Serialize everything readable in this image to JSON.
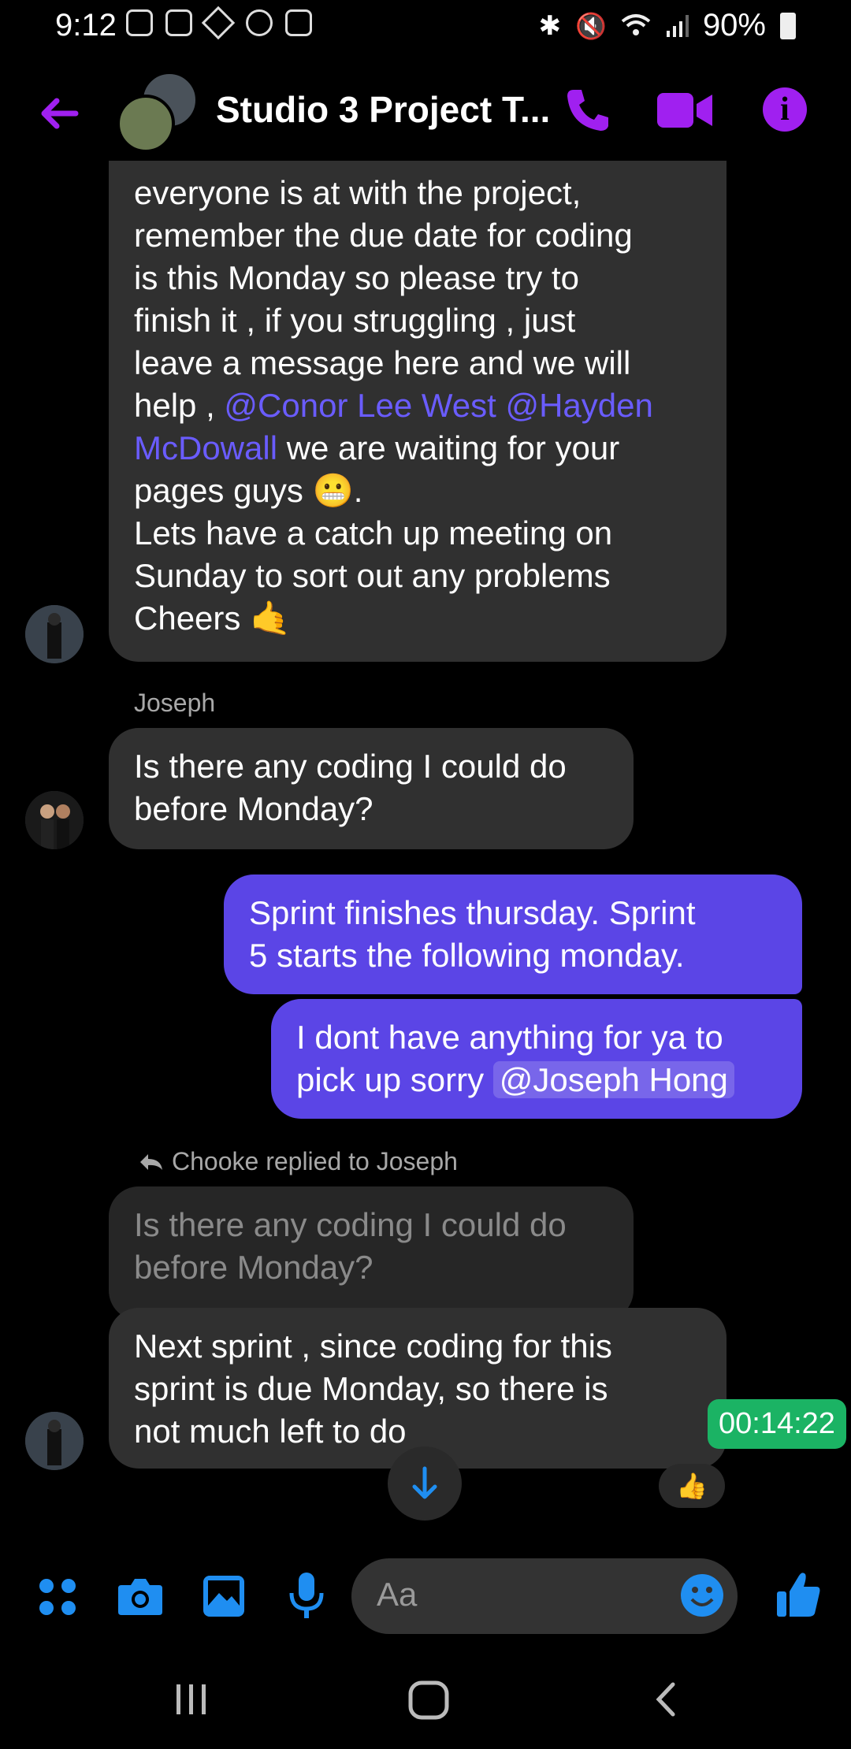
{
  "status_bar": {
    "time": "9:12",
    "battery": "90%"
  },
  "header": {
    "title": "Studio 3 Project T...",
    "accent_color": "#a020f0"
  },
  "messages": {
    "first": {
      "lines": [
        "everyone is at with the project,",
        "remember the due date for coding",
        "is this Monday so please try to",
        "finish it , if you struggling , just",
        "leave a message here and we will"
      ],
      "help_prefix": "help , ",
      "mention1": "@Conor Lee West @Hayden",
      "mention2": "McDowall",
      "after_mention": " we are waiting for your",
      "pages_line": "pages guys 😬.",
      "line_catchup1": "Lets have a catch up meeting on",
      "line_catchup2": "Sunday to sort out any problems",
      "line_cheers": "Cheers 🤙"
    },
    "joseph": {
      "sender": "Joseph",
      "text1": "Is there any coding I could do",
      "text2": "before Monday?"
    },
    "mine1": {
      "text1": "Sprint finishes thursday. Sprint",
      "text2": "5 starts the following monday."
    },
    "mine2": {
      "text1": "I dont have anything for ya to",
      "text2_prefix": "pick up sorry ",
      "mention": "@Joseph Hong"
    },
    "reply": {
      "label": "Chooke replied to Joseph",
      "quoted1": "Is there any coding I could do",
      "quoted2": "before Monday?",
      "text1": "Next sprint , since coding for this",
      "text2": "sprint is due Monday, so there is",
      "text3": "not much left to do",
      "reaction": "👍"
    }
  },
  "timestamp": "00:14:22",
  "composer": {
    "placeholder": "Aa"
  }
}
